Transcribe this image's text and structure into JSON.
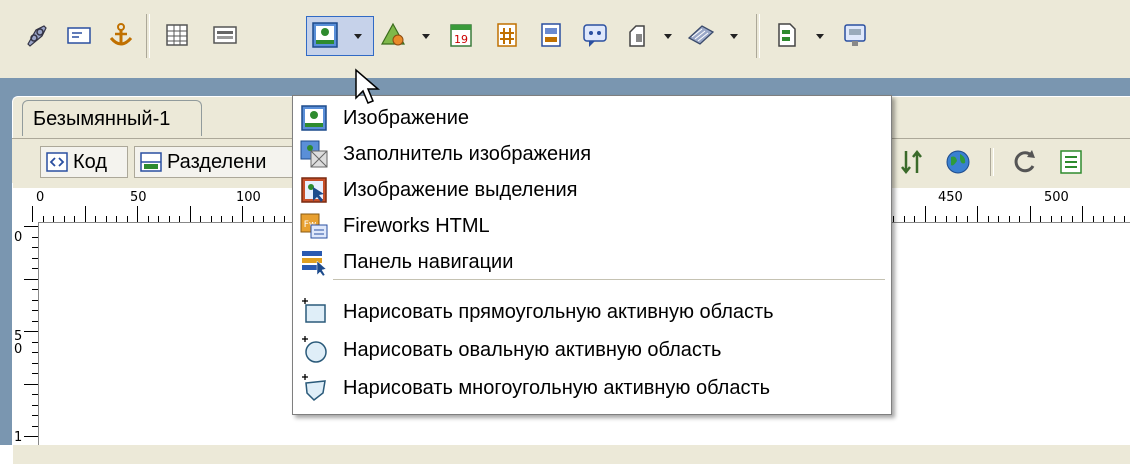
{
  "document": {
    "tab_title": "Безымянный-1",
    "view_buttons": [
      {
        "label": "Код",
        "icon": "code-view-icon"
      },
      {
        "label": "Разделени",
        "icon": "split-view-icon"
      }
    ]
  },
  "ruler": {
    "h_labels": [
      "0",
      "50",
      "100",
      "450",
      "500"
    ],
    "v_labels": [
      "0",
      "5\n0",
      "1"
    ]
  },
  "insert_menu": {
    "items": [
      {
        "label": "Изображение",
        "icon": "image-icon"
      },
      {
        "label": "Заполнитель изображения",
        "icon": "image-placeholder-icon"
      },
      {
        "label": "Изображение выделения",
        "icon": "rollover-image-icon"
      },
      {
        "label": "Fireworks HTML",
        "icon": "fireworks-html-icon"
      },
      {
        "label": "Панель навигации",
        "icon": "navigation-bar-icon"
      }
    ],
    "hotspot_items": [
      {
        "label": "Нарисовать прямоугольную активную область",
        "icon": "rect-hotspot-icon"
      },
      {
        "label": "Нарисовать овальную активную область",
        "icon": "oval-hotspot-icon"
      },
      {
        "label": "Нарисовать многоугольную активную область",
        "icon": "polygon-hotspot-icon"
      }
    ]
  },
  "colors": {
    "toolbar_bg": "#ece9d8",
    "frame_bg": "#7a96b0",
    "selection_blue": "#316ac5"
  }
}
